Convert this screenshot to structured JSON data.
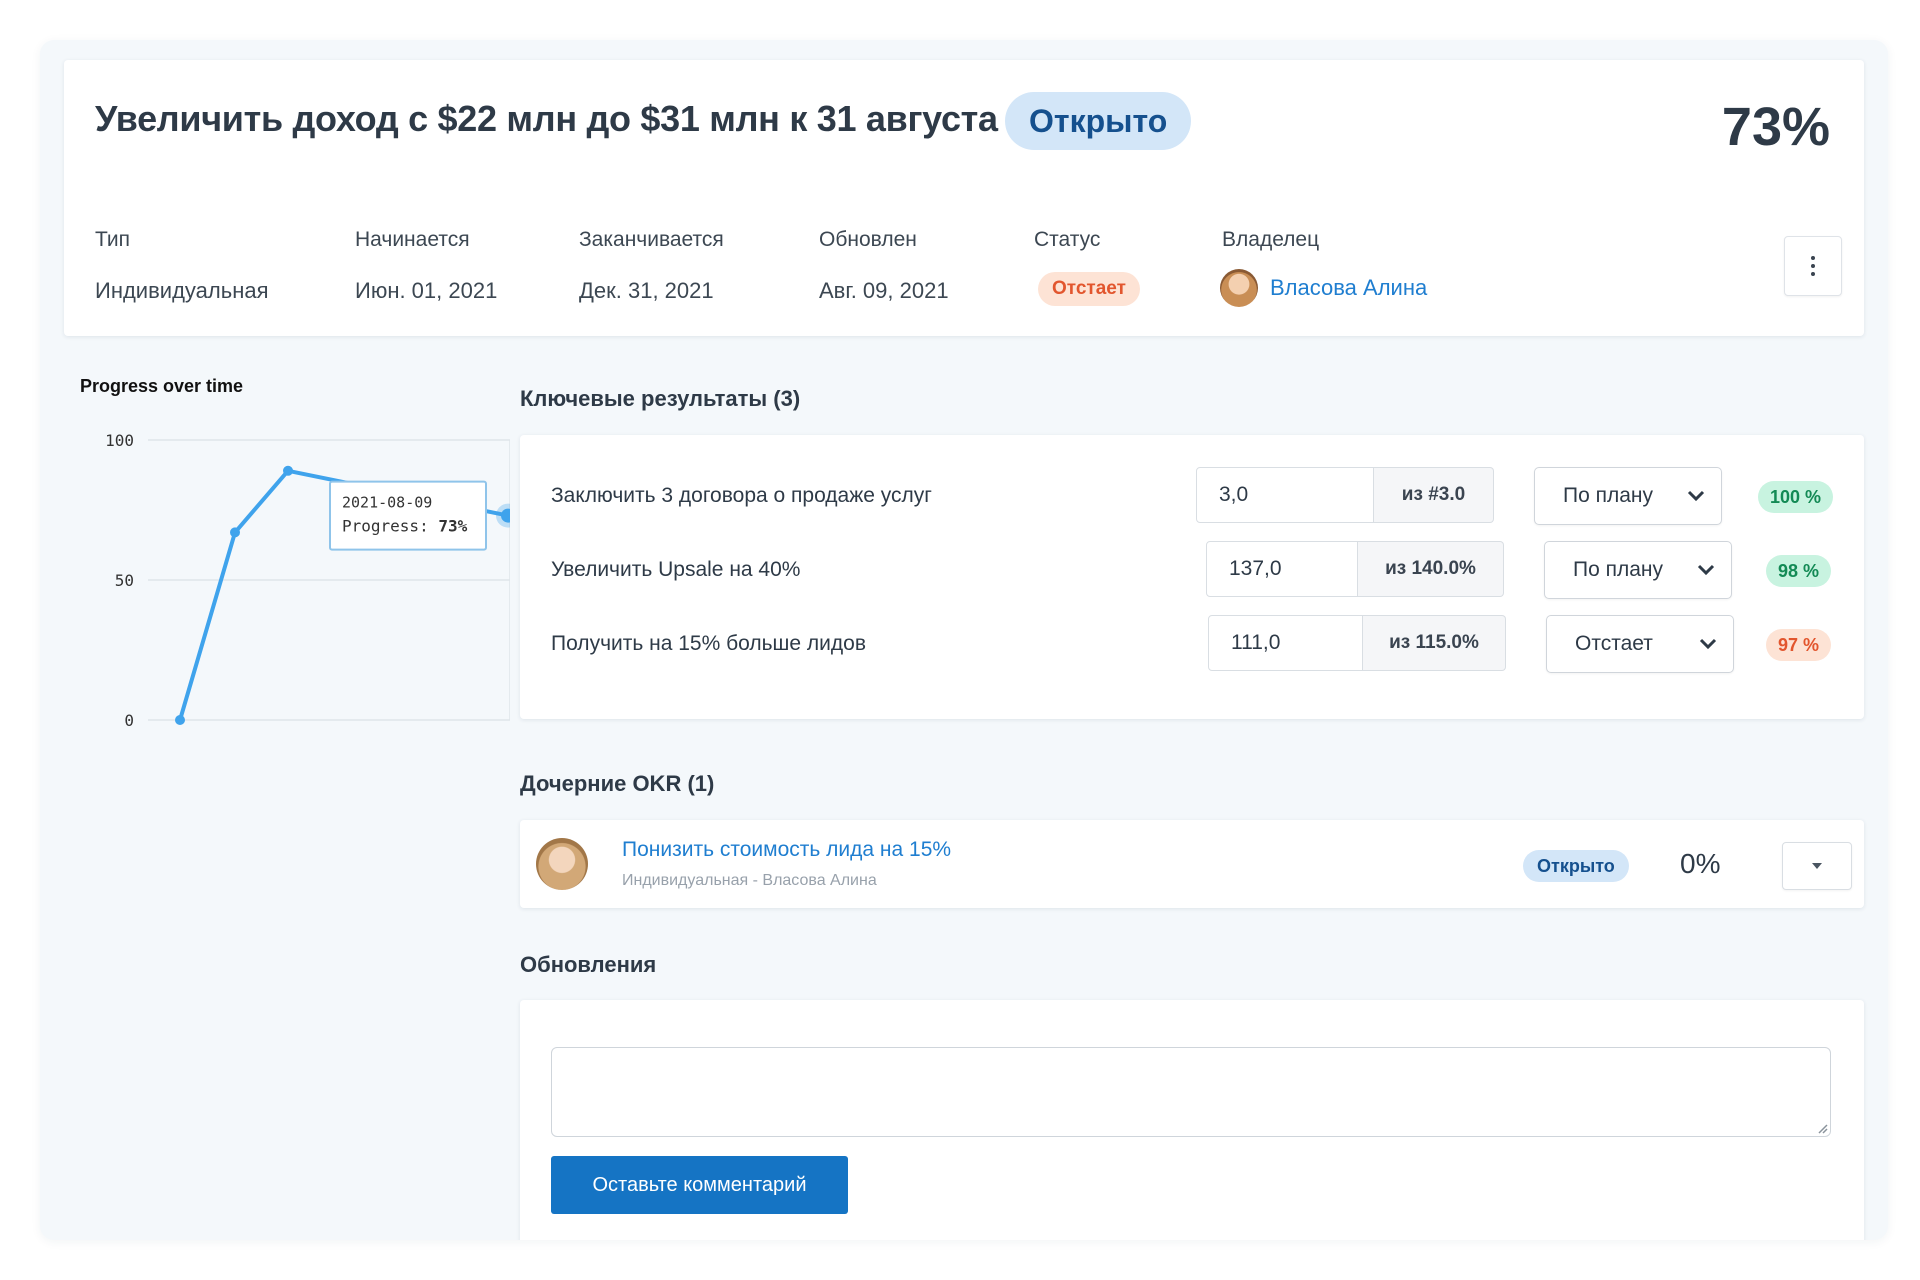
{
  "objective": {
    "title": "Увеличить доход с $22 млн до $31 млн к 31 августа",
    "status_pill": "Открыто",
    "progress": "73%",
    "meta": [
      {
        "label": "Тип",
        "value": "Индивидуальная"
      },
      {
        "label": "Начинается",
        "value": "Июн. 01, 2021"
      },
      {
        "label": "Заканчивается",
        "value": "Дек. 31, 2021"
      },
      {
        "label": "Обновлен",
        "value": "Авг. 09, 2021"
      },
      {
        "label": "Статус",
        "value": "Отстает"
      },
      {
        "label": "Владелец",
        "value": "Власова Алина"
      }
    ]
  },
  "chart": {
    "title": "Progress over time",
    "tooltip": {
      "date": "2021-08-09",
      "label": "Progress:",
      "value": "73%"
    }
  },
  "chart_data": {
    "type": "line",
    "title": "Progress over time",
    "xlabel": "",
    "ylabel": "",
    "ylim": [
      0,
      100
    ],
    "yticks": [
      "0",
      "50",
      "100"
    ],
    "grid": true,
    "x": [
      "2021-06-01",
      "2021-06-15",
      "2021-07-04",
      "2021-08-09"
    ],
    "values": [
      0,
      67,
      89,
      73
    ],
    "color": "#3fa3ec"
  },
  "key_results": {
    "title": "Ключевые результаты (3)",
    "items": [
      {
        "label": "Заключить 3 договора о продаже услуг",
        "value": "3,0",
        "target": "из #3.0",
        "status": "По плану",
        "pct": "100 %",
        "pct_kind": "good"
      },
      {
        "label": "Увеличить Upsale на 40%",
        "value": "137,0",
        "target": "из 140.0%",
        "status": "По плану",
        "pct": "98 %",
        "pct_kind": "good"
      },
      {
        "label": "Получить на 15% больше лидов",
        "value": "111,0",
        "target": "из 115.0%",
        "status": "Отстает",
        "pct": "97 %",
        "pct_kind": "bad"
      }
    ]
  },
  "child_okrs": {
    "title": "Дочерние OKR (1)",
    "items": [
      {
        "title": "Понизить стоимость лида на 15%",
        "subtitle": "Индивидуальная - Власова Алина",
        "status": "Открыто",
        "pct": "0%"
      }
    ]
  },
  "updates": {
    "title": "Обновления",
    "placeholder": "",
    "button_label": "Оставьте комментарий"
  },
  "colors": {
    "accent": "#1574c4",
    "link": "#1f7ed0",
    "open_pill_bg": "#d3e6f8",
    "good_bg": "#c8f3e0",
    "good_fg": "#138a55",
    "bad_bg": "#fde3d5",
    "bad_fg": "#e2562e"
  },
  "icons": {
    "more": "kebab-icon",
    "dropdown": "chevron-down-icon",
    "expand": "caret-down-icon",
    "resize": "resize-grip-icon"
  }
}
